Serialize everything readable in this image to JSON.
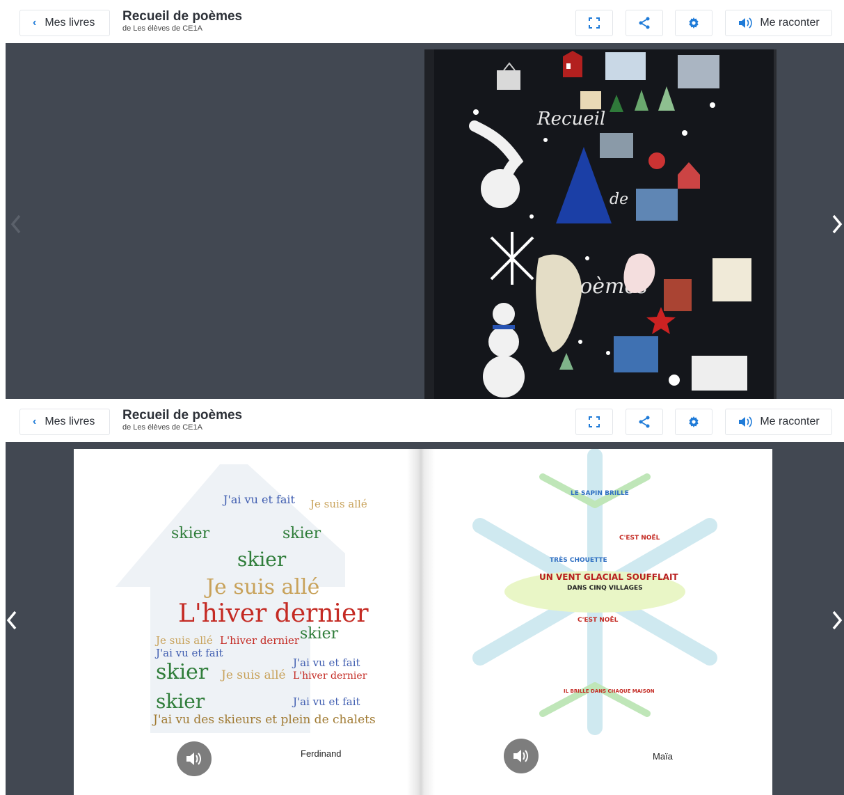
{
  "header": {
    "back_label": "Mes livres",
    "title": "Recueil de poèmes",
    "author": "de Les élèves de CE1A",
    "narrate_label": "Me raconter"
  },
  "cover": {
    "title_word_1": "Recueil",
    "title_word_2": "de",
    "title_word_3": "poèmes"
  },
  "left_page": {
    "words_big": "L'hiver dernier",
    "words_med": "Je suis allé",
    "words_skier": "skier",
    "words_vu": "J'ai vu et fait",
    "words_bottom": "J'ai vu des skieurs et plein de chalets",
    "author": "Ferdinand"
  },
  "right_page": {
    "phrase_1": "UN VENT GLACIAL SOUFFLAIT",
    "phrase_2": "DANS CINQ VILLAGES",
    "phrase_3": "LE SAPIN BRILLE",
    "phrase_4": "C'EST NOËL",
    "phrase_5": "TRÈS CHOUETTE",
    "phrase_6": "IL BRILLE DANS CHAQUE MAISON",
    "author": "Maïa"
  },
  "colors": {
    "accent": "#1f7bd8",
    "stage": "#424852",
    "audio": "#7d7d7d"
  }
}
